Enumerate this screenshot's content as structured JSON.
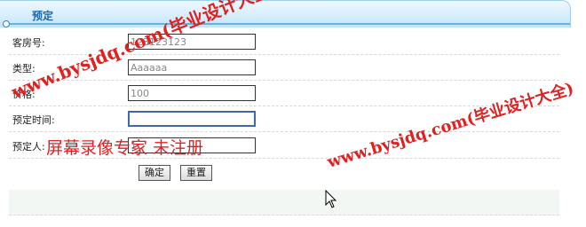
{
  "panel": {
    "title": "预定"
  },
  "form": {
    "fields": [
      {
        "label": "客房号:",
        "value": "123123123"
      },
      {
        "label": "类型:",
        "value": "Aaaaaa"
      },
      {
        "label": "价格:",
        "value": "100"
      },
      {
        "label": "预定时间:",
        "value": ""
      },
      {
        "label": "预定人:",
        "value": "1"
      }
    ],
    "submit_label": "确定",
    "reset_label": "重置"
  },
  "watermarks": {
    "site_a": "www.bysjdq.com(毕业设计大全)",
    "site_b": "www.bysjdq.com(毕业设计大全)",
    "recorder": "屏幕录像专家  未注册"
  },
  "colors": {
    "header_title": "#1f67a8",
    "header_line": "#63b3e0",
    "watermark": "#e12020"
  }
}
